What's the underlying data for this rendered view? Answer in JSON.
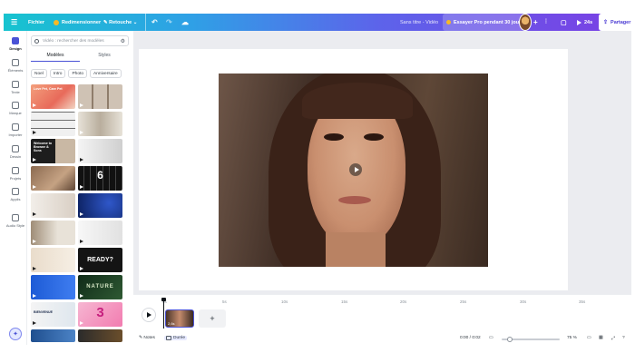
{
  "topbar": {
    "menu_label": "Fichier",
    "resize_label": "Redimensionner",
    "edit_label": "Retouche",
    "doc_title": "Sans titre - Vidéo",
    "pro_trial_label": "Essayer Pro pendant 30 jours",
    "present_label": "24s",
    "share_label": "Partager"
  },
  "rail": {
    "items": [
      {
        "label": "Design"
      },
      {
        "label": "Éléments"
      },
      {
        "label": "Texte"
      },
      {
        "label": "Marque"
      },
      {
        "label": "Importer"
      },
      {
        "label": "Dessin"
      },
      {
        "label": "Projets"
      },
      {
        "label": "Applis"
      },
      {
        "label": "Audio Style"
      }
    ]
  },
  "panel": {
    "search_placeholder": "Vidéo : rechercher des modèles",
    "tabs": [
      "Modèles",
      "Styles"
    ],
    "chips": [
      "Noel",
      "Intro",
      "Photo",
      "Anniversaire"
    ],
    "templates": [
      {
        "label": "Love Pet, Care Pet"
      },
      {
        "label": ""
      },
      {
        "label": ""
      },
      {
        "label": ""
      },
      {
        "label": "Welcome to Browne & Sons"
      },
      {
        "label": ""
      },
      {
        "label": ""
      },
      {
        "label": "6"
      },
      {
        "label": ""
      },
      {
        "label": ""
      },
      {
        "label": ""
      },
      {
        "label": ""
      },
      {
        "label": ""
      },
      {
        "label": "READY?"
      },
      {
        "label": ""
      },
      {
        "label": "NATURE"
      },
      {
        "label": "BIENVENUE"
      },
      {
        "label": "3"
      }
    ]
  },
  "timeline": {
    "ticks": [
      "0s",
      "5s",
      "10s",
      "15s",
      "20s",
      "25s",
      "30s",
      "35s"
    ],
    "clip_duration": "2,6s",
    "add_symbol": "+"
  },
  "bottombar": {
    "notes_label": "Notes",
    "duration_label": "Durée",
    "time_readout": "0:00 / 0:02",
    "zoom": "75 %"
  },
  "colors": {
    "accent": "#4a52d6",
    "topbar_start": "#17c3cf",
    "topbar_end": "#7b3fe4"
  }
}
